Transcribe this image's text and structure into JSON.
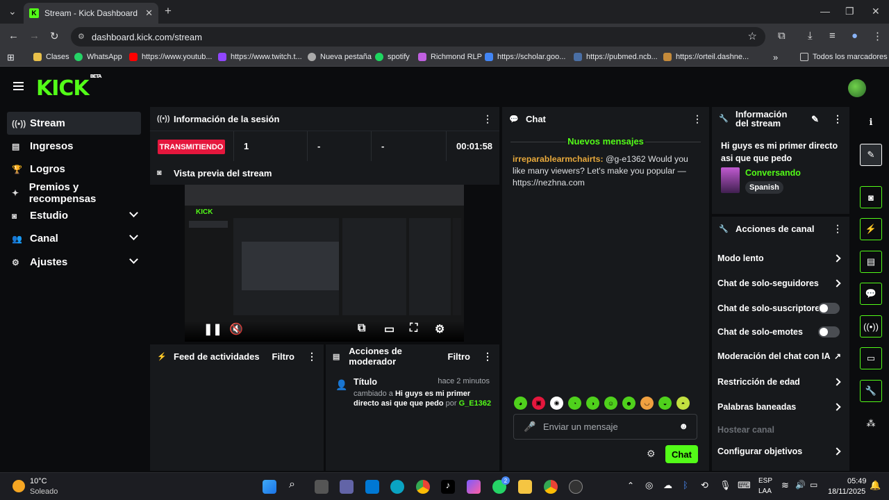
{
  "browser": {
    "tab_title": "Stream - Kick Dashboard",
    "url": "dashboard.kick.com/stream",
    "bookmarks": [
      "Clases",
      "WhatsApp",
      "https://www.youtub...",
      "https://www.twitch.t...",
      "Nueva pestaña",
      "spotify",
      "Richmond RLP",
      "https://scholar.goo...",
      "https://pubmed.ncb...",
      "https://orteil.dashne..."
    ],
    "all_bookmarks": "Todos los marcadores"
  },
  "brand": {
    "logo": "KICK",
    "beta": "BETA",
    "accent": "#53fc18"
  },
  "sidebar": {
    "items": [
      {
        "label": "Stream",
        "icon": "broadcast-icon"
      },
      {
        "label": "Ingresos",
        "icon": "chart-icon"
      },
      {
        "label": "Logros",
        "icon": "trophy-icon"
      },
      {
        "label": "Premios y recompensas",
        "icon": "gift-icon"
      },
      {
        "label": "Estudio",
        "icon": "camera-icon"
      },
      {
        "label": "Canal",
        "icon": "users-icon"
      },
      {
        "label": "Ajustes",
        "icon": "gear-icon"
      }
    ]
  },
  "session": {
    "title": "Información de la sesión",
    "status": "TRANSMITIENDO",
    "viewers": "1",
    "stat2": "-",
    "stat3": "-",
    "duration": "00:01:58"
  },
  "preview": {
    "title": "Vista previa del stream"
  },
  "feed": {
    "title": "Feed de actividades",
    "filter": "Filtro"
  },
  "moderator": {
    "title": "Acciones de moderador",
    "filter": "Filtro",
    "entry_title": "Título",
    "entry_time": "hace 2 minutos",
    "entry_prefix": "cambiado a",
    "entry_value": "Hi guys es mi primer directo asi que que pedo",
    "entry_by": "por",
    "entry_user": "G_E1362"
  },
  "chat": {
    "title": "Chat",
    "new_messages": "Nuevos mensajes",
    "message_user": "irreparablearmchairts:",
    "message_text": "@g-e1362 Would you like many viewers? Let's make you popular — https://nezhna.com",
    "input_placeholder": "Enviar un mensaje",
    "send_label": "Chat"
  },
  "stream_info": {
    "title": "Información del stream",
    "stream_title": "Hi guys es mi primer directo asi que que pedo",
    "category": "Conversando",
    "language": "Spanish"
  },
  "channel_actions": {
    "title": "Acciones de canal",
    "items": [
      "Modo lento",
      "Chat de solo-seguidores",
      "Chat de solo-suscriptores",
      "Chat de solo-emotes",
      "Moderación del chat con IA",
      "Restricción de edad",
      "Palabras baneadas",
      "Hostear canal",
      "Configurar objetivos"
    ]
  },
  "taskbar": {
    "temp": "10°C",
    "weather": "Soleado",
    "lang1": "ESP",
    "lang2": "LAA",
    "time": "05:49",
    "date": "18/11/2025",
    "whatsapp_badge": "2"
  }
}
